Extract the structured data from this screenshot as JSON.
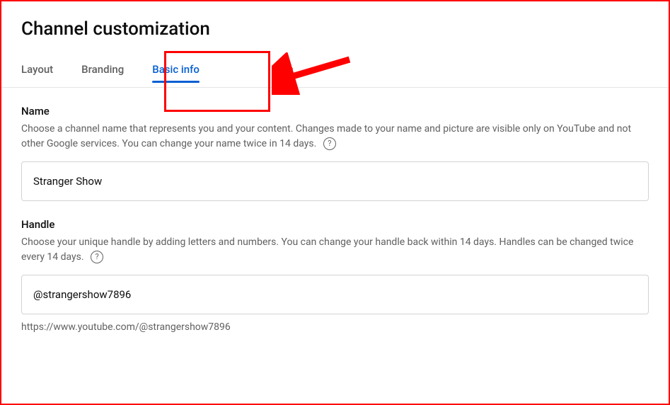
{
  "header": {
    "title": "Channel customization"
  },
  "tabs": {
    "layout": "Layout",
    "branding": "Branding",
    "basic_info": "Basic info"
  },
  "name_section": {
    "title": "Name",
    "desc_part1": "Choose a channel name that represents you and your content. Changes made to your name and picture are visible only on YouTube and not other Google services. You can change your name twice in 14 days.",
    "value": "Stranger Show"
  },
  "handle_section": {
    "title": "Handle",
    "desc_part1": "Choose your unique handle by adding letters and numbers. You can change your handle back within 14 days. Handles can be changed twice every 14 days.",
    "value": "@strangershow7896",
    "url": "https://www.youtube.com/@strangershow7896"
  },
  "help_icon_glyph": "?"
}
